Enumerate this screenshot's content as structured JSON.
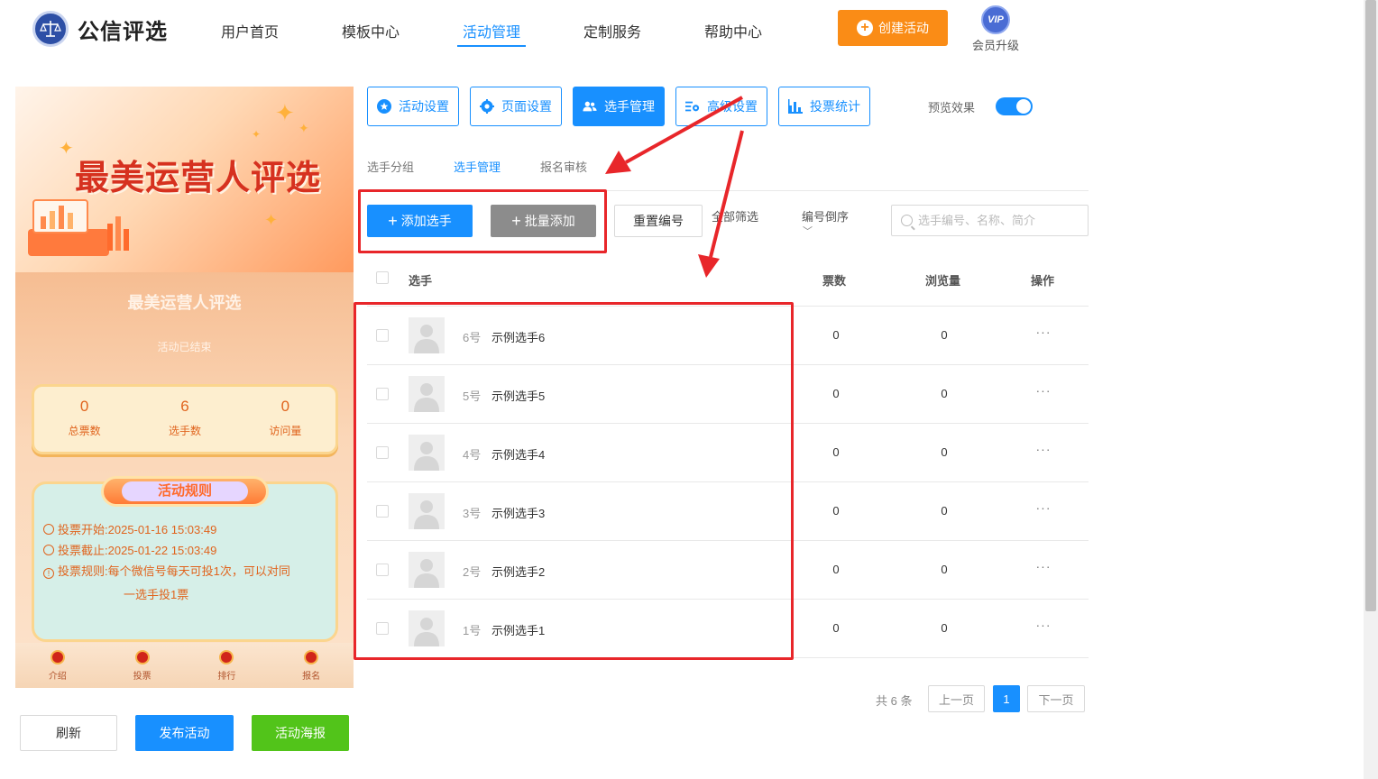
{
  "logo": {
    "text": "公信评选"
  },
  "nav": {
    "items": [
      "用户首页",
      "模板中心",
      "活动管理",
      "定制服务",
      "帮助中心"
    ],
    "active_index": 2,
    "create_label": "创建活动",
    "vip_badge": "VIP",
    "vip_label": "会员升级"
  },
  "preview": {
    "banner_title": "最美运营人评选",
    "title": "最美运营人评选",
    "status": "活动已结束",
    "stats": [
      {
        "value": "0",
        "label": "总票数"
      },
      {
        "value": "6",
        "label": "选手数"
      },
      {
        "value": "0",
        "label": "访问量"
      }
    ],
    "rules_title": "活动规则",
    "rules": {
      "start_label": "投票开始:",
      "start_value": "2025-01-16 15:03:49",
      "end_label": "投票截止:",
      "end_value": "2025-01-22 15:03:49",
      "rule_label": "投票规则:",
      "rule_value_1": "每个微信号每天可投1次，可以对同",
      "rule_value_2": "一选手投1票"
    },
    "tabs": [
      "介绍",
      "投票",
      "排行",
      "报名"
    ]
  },
  "actions": {
    "refresh": "刷新",
    "publish": "发布活动",
    "poster": "活动海报"
  },
  "settings_tabs": [
    "活动设置",
    "页面设置",
    "选手管理",
    "高级设置",
    "投票统计"
  ],
  "settings_active": 2,
  "preview_toggle": {
    "label": "预览效果",
    "on": true
  },
  "sub_tabs": [
    "选手分组",
    "选手管理",
    "报名审核"
  ],
  "sub_active": 1,
  "toolbar": {
    "add": "添加选手",
    "batch": "批量添加",
    "reset": "重置编号",
    "filter_all": "全部筛选",
    "order": "编号倒序",
    "search_placeholder": "选手编号、名称、简介"
  },
  "table": {
    "headers": {
      "player": "选手",
      "votes": "票数",
      "views": "浏览量",
      "ops": "操作"
    },
    "rows": [
      {
        "num": "6号",
        "name": "示例选手6",
        "votes": "0",
        "views": "0",
        "more": "···"
      },
      {
        "num": "5号",
        "name": "示例选手5",
        "votes": "0",
        "views": "0",
        "more": "···"
      },
      {
        "num": "4号",
        "name": "示例选手4",
        "votes": "0",
        "views": "0",
        "more": "···"
      },
      {
        "num": "3号",
        "name": "示例选手3",
        "votes": "0",
        "views": "0",
        "more": "···"
      },
      {
        "num": "2号",
        "name": "示例选手2",
        "votes": "0",
        "views": "0",
        "more": "···"
      },
      {
        "num": "1号",
        "name": "示例选手1",
        "votes": "0",
        "views": "0",
        "more": "···"
      }
    ]
  },
  "pagination": {
    "total": "共 6 条",
    "prev": "上一页",
    "current": "1",
    "next": "下一页"
  },
  "colors": {
    "primary": "#1890ff",
    "orange": "#fa8c16",
    "green": "#52c41a",
    "annotation": "#e8262a"
  }
}
